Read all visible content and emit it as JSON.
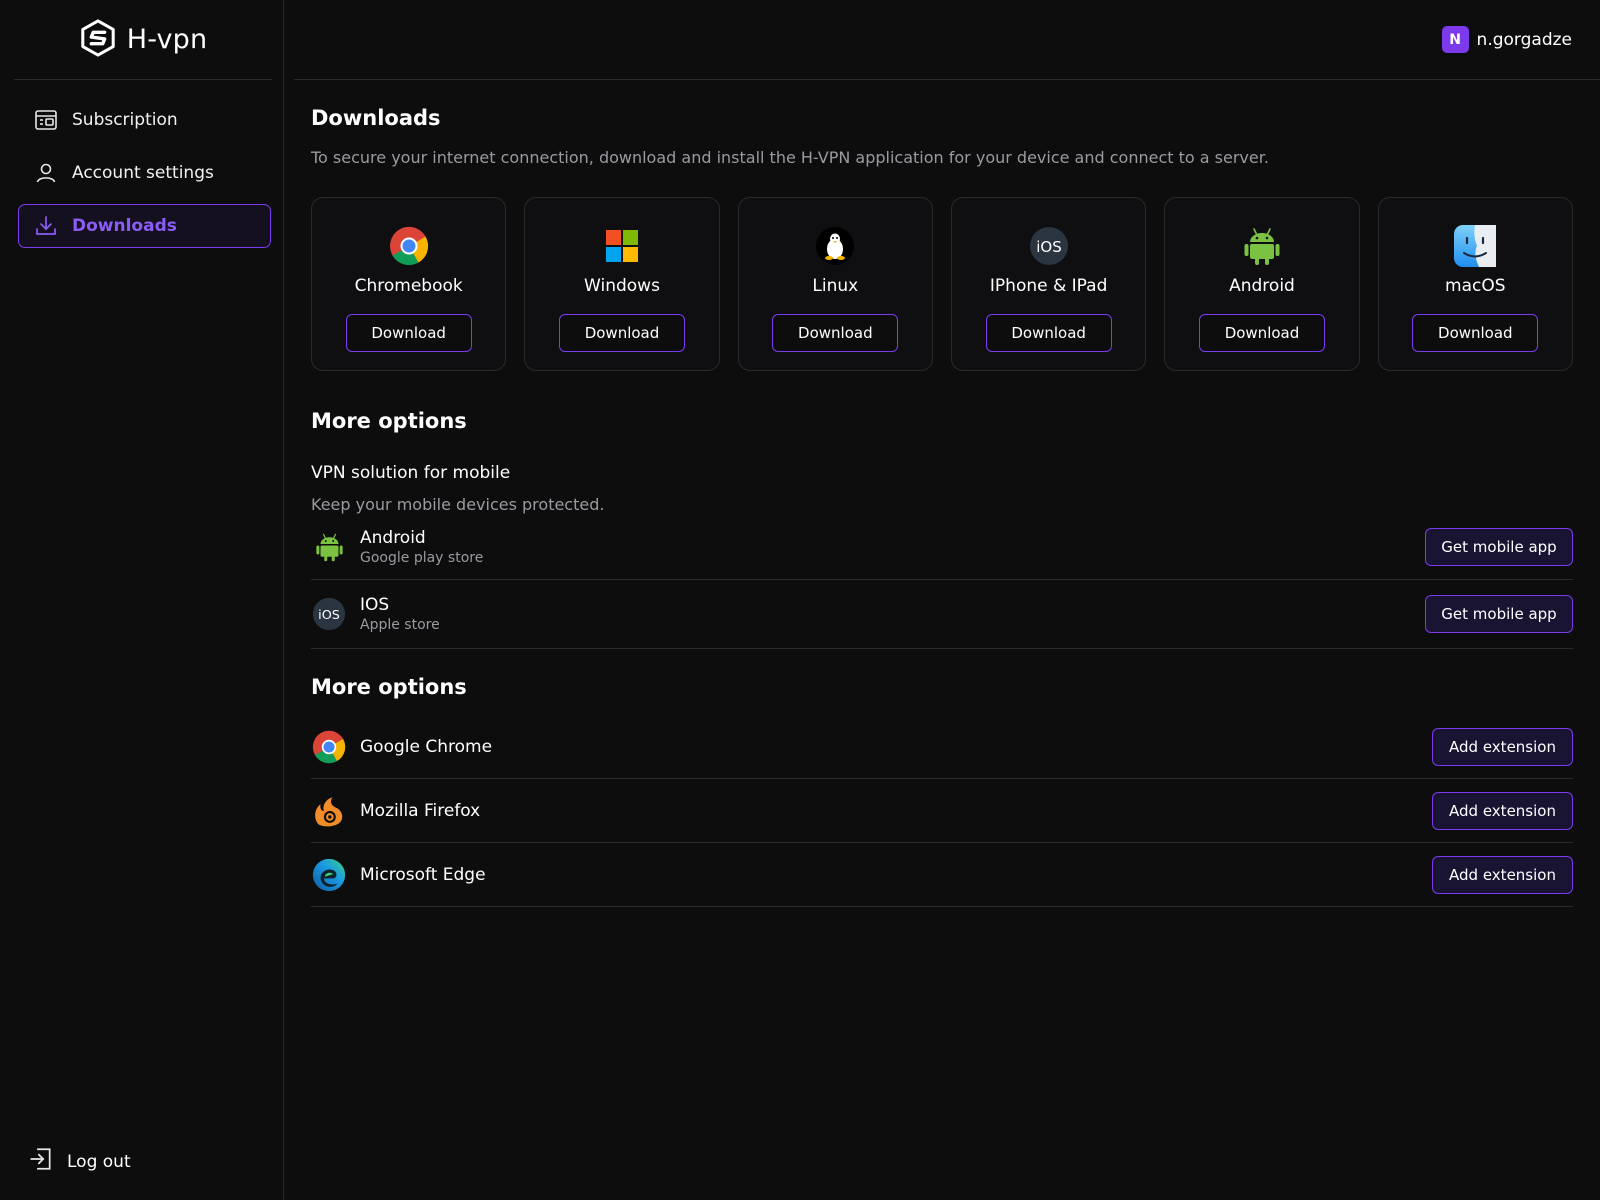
{
  "app": {
    "name": "H-vpn"
  },
  "sidebar": {
    "items": [
      {
        "label": "Subscription",
        "icon": "subscription-icon"
      },
      {
        "label": "Account settings",
        "icon": "user-icon"
      },
      {
        "label": "Downloads",
        "icon": "download-icon",
        "active": true
      }
    ],
    "logout": "Log out"
  },
  "user": {
    "initial": "N",
    "name": "n.gorgadze"
  },
  "downloads": {
    "title": "Downloads",
    "description": "To secure your internet connection, download and install the H-VPN application for your device and connect to a server.",
    "platforms": [
      {
        "name": "Chromebook",
        "icon": "chrome-icon",
        "button": "Download"
      },
      {
        "name": "Windows",
        "icon": "windows-icon",
        "button": "Download"
      },
      {
        "name": "Linux",
        "icon": "linux-icon",
        "button": "Download"
      },
      {
        "name": "IPhone & IPad",
        "icon": "ios-icon",
        "button": "Download"
      },
      {
        "name": "Android",
        "icon": "android-icon",
        "button": "Download"
      },
      {
        "name": "macOS",
        "icon": "macos-icon",
        "button": "Download"
      }
    ]
  },
  "more_options_mobile": {
    "title": "More options",
    "subtitle": "VPN solution for mobile",
    "description": "Keep your mobile devices protected.",
    "items": [
      {
        "name": "Android",
        "store": "Google play store",
        "icon": "android-icon",
        "button": "Get mobile app"
      },
      {
        "name": "IOS",
        "store": "Apple store",
        "icon": "ios-icon",
        "button": "Get mobile app"
      }
    ]
  },
  "more_options_browser": {
    "title": "More options",
    "items": [
      {
        "name": "Google Chrome",
        "icon": "chrome-icon",
        "button": "Add extension"
      },
      {
        "name": "Mozilla Firefox",
        "icon": "firefox-icon",
        "button": "Add extension"
      },
      {
        "name": "Microsoft Edge",
        "icon": "edge-icon",
        "button": "Add extension"
      }
    ]
  },
  "colors": {
    "accent": "#7c3aed",
    "background": "#0d0d0e",
    "border": "#2a2a2d",
    "muted_text": "#9a9aa1"
  }
}
